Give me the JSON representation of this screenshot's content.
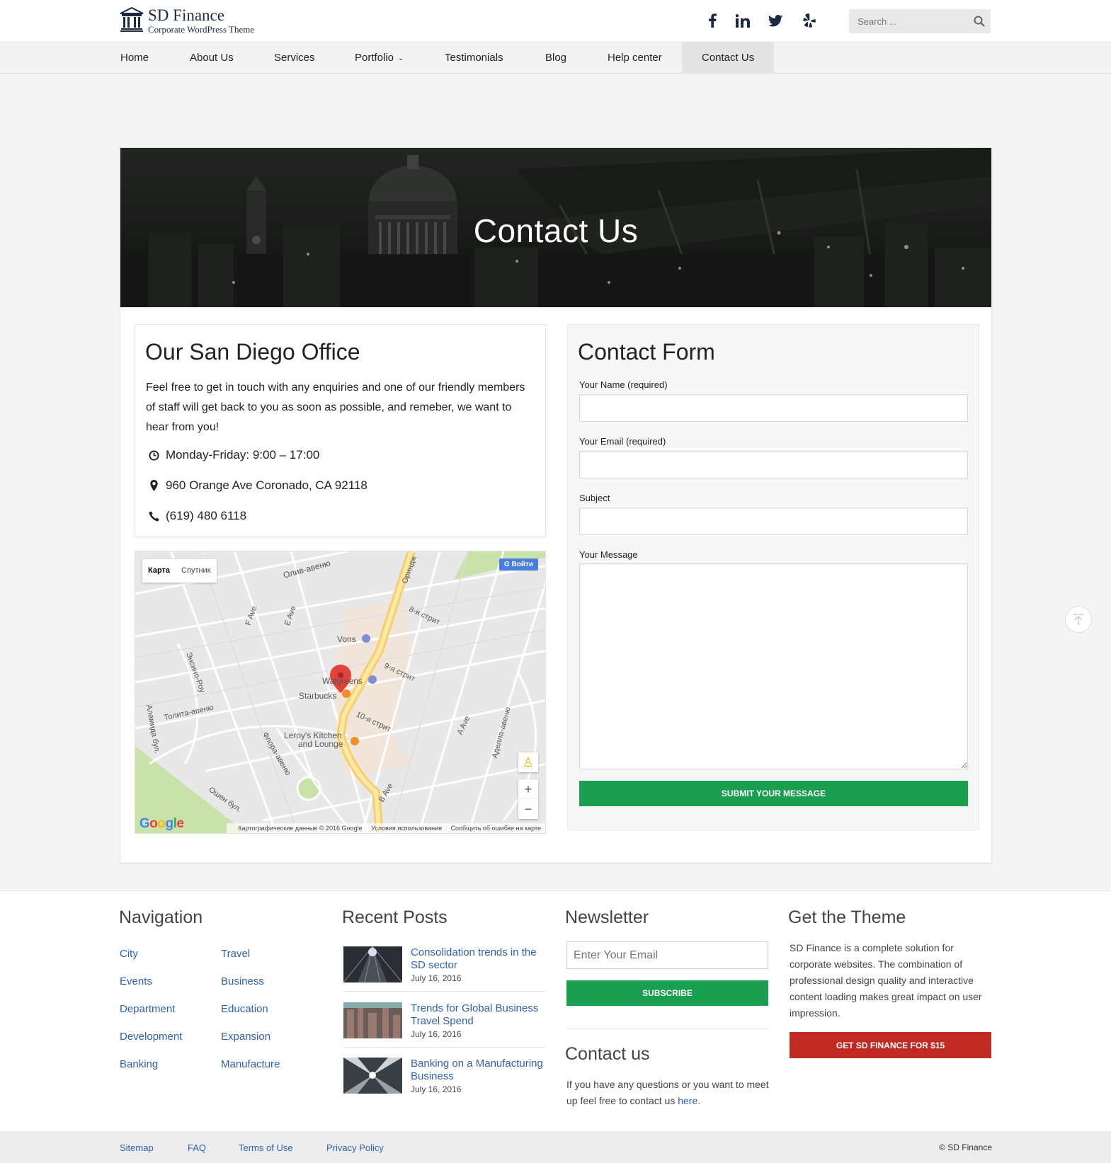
{
  "brand": {
    "title": "SD Finance",
    "subtitle": "Corporate WordPress Theme"
  },
  "social": [
    "facebook-icon",
    "linkedin-icon",
    "twitter-icon",
    "yelp-icon"
  ],
  "search": {
    "placeholder": "Search ..."
  },
  "nav": {
    "items": [
      {
        "label": "Home"
      },
      {
        "label": "About Us"
      },
      {
        "label": "Services"
      },
      {
        "label": "Portfolio"
      },
      {
        "label": "Testimonials"
      },
      {
        "label": "Blog"
      },
      {
        "label": "Help center"
      },
      {
        "label": "Contact Us"
      }
    ],
    "active": "Contact Us"
  },
  "banner": {
    "title": "Contact Us"
  },
  "office": {
    "title": "Our San Diego Office",
    "text": "Feel free to get in touch with any enquiries and one of our friendly members of staff will get back to you as soon as possible, and remeber, we want to hear from you!",
    "hours": "Monday-Friday: 9:00 – 17:00",
    "address": "960 Orange Ave Coronado, CA 92118",
    "phone": "(619) 480 6118"
  },
  "map": {
    "tab_map": "Карта",
    "tab_satellite": "Спутник",
    "login": "Войти",
    "zoom_in": "+",
    "zoom_out": "−",
    "footer_data": "Картографические данные © 2016 Google",
    "footer_terms": "Условия использования",
    "footer_report": "Сообщить об ошибке на карте",
    "labels": {
      "olive": "Олив-авеню",
      "vons": "Vons",
      "walgreens": "Walgreens",
      "starbucks": "Starbucks",
      "leroys": "Leroy's Kitchen",
      "leroys2": "and Lounge",
      "st8": "8-я стрит",
      "st9": "9-я стрит",
      "st10": "10-я стрит",
      "tolita": "Толита-авеню",
      "flora": "Флора-авеню",
      "ocean": "Ошен бул.",
      "bave": "B Ave",
      "aave": "A Ave",
      "fave": "F Ave",
      "eave": "E Ave",
      "orange": "Ориндж",
      "adella": "Аделла-авеню",
      "encino": "Энсино-Роу",
      "alameda": "Аламида бул."
    }
  },
  "form": {
    "title": "Contact Form",
    "name_label": "Your Name (required)",
    "email_label": "Your Email (required)",
    "subject_label": "Subject",
    "message_label": "Your Message",
    "submit": "SUBMIT YOUR MESSAGE"
  },
  "footer": {
    "nav_title": "Navigation",
    "nav_col1": [
      "City",
      "Events",
      "Department",
      "Development",
      "Banking"
    ],
    "nav_col2": [
      "Travel",
      "Business",
      "Education",
      "Expansion",
      "Manufacture"
    ],
    "posts_title": "Recent Posts",
    "posts": [
      {
        "title": "Consolidation trends in the SD sector",
        "date": "July 16, 2016"
      },
      {
        "title": "Trends for Global Business Travel Spend",
        "date": "July 16, 2016"
      },
      {
        "title": "Banking on a Manufacturing Business",
        "date": "July 16, 2016"
      }
    ],
    "newsletter_title": "Newsletter",
    "newsletter_placeholder": "Enter Your Email",
    "subscribe": "SUBSCRIBE",
    "contact_title": "Contact us",
    "contact_text": "If you have any questions or you want to meet up feel free to contact us",
    "contact_link": "here",
    "contact_end": ".",
    "theme_title": "Get the Theme",
    "theme_text": "SD Finance is a complete solution for corporate websites. The combination of professional design quality and interactive content loading makes great impact on user impression.",
    "theme_button": "GET SD FINANCE FOR $15"
  },
  "bottom": {
    "links": [
      "Sitemap",
      "FAQ",
      "Terms of Use",
      "Privacy Policy"
    ],
    "copyright": "© SD Finance"
  },
  "colors": {
    "accent_green": "#1a9e50",
    "accent_red": "#c02a22",
    "link_blue": "#2f5fb3",
    "brand_navy": "#1c2a3f"
  }
}
